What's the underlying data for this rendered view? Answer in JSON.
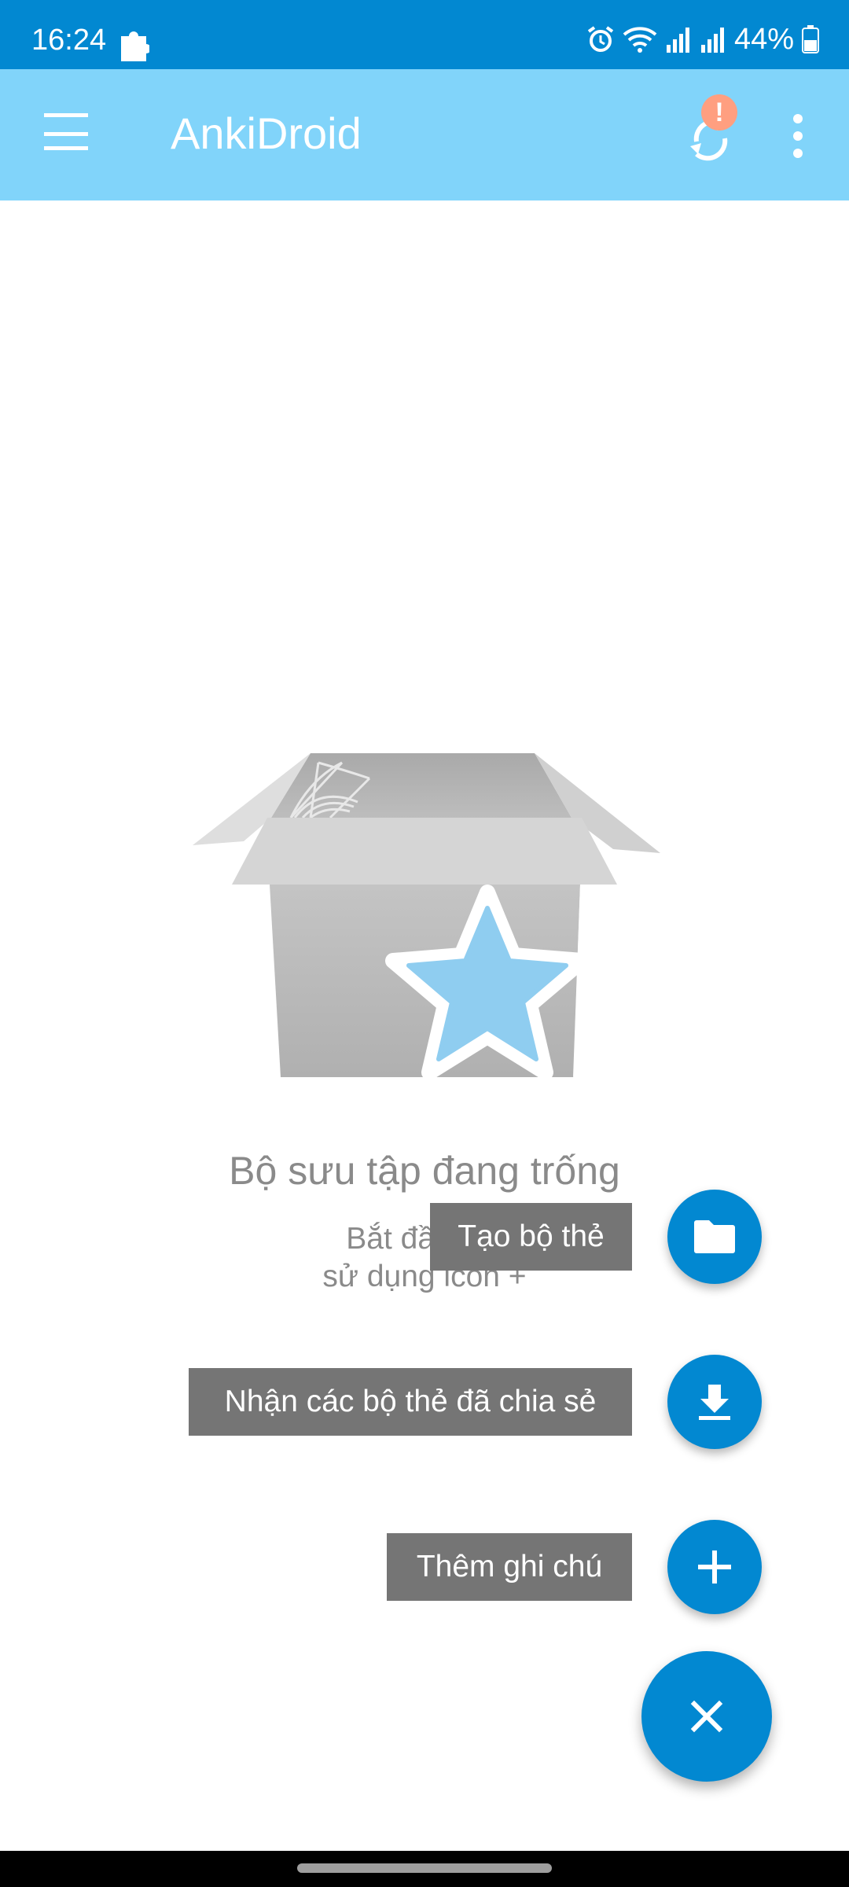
{
  "status_bar": {
    "time": "16:24",
    "battery": "44%",
    "icons": [
      "puzzle-icon",
      "alarm-icon",
      "wifi-icon",
      "signal-icon",
      "signal-icon",
      "battery-icon"
    ]
  },
  "app_bar": {
    "title": "AnkiDroid",
    "sync_badge": "!",
    "icons": [
      "menu-icon",
      "sync-icon",
      "more-vert-icon"
    ]
  },
  "empty_state": {
    "title": "Bộ sưu tập đang trống",
    "subtitle_line1": "Bắt đầu thê",
    "subtitle_line2": "sử dụng icon +"
  },
  "speed_dial": {
    "create_deck_label": "Tạo bộ thẻ",
    "shared_decks_label": "Nhận các bộ thẻ đã chia sẻ",
    "add_note_label": "Thêm ghi chú",
    "icons": [
      "folder-icon",
      "download-icon",
      "plus-icon",
      "close-icon"
    ]
  },
  "colors": {
    "status_bar": "#0288d1",
    "app_bar": "#81d4fa",
    "fab": "#0288d1",
    "label_bg": "#757575",
    "badge": "#ff9f80"
  }
}
